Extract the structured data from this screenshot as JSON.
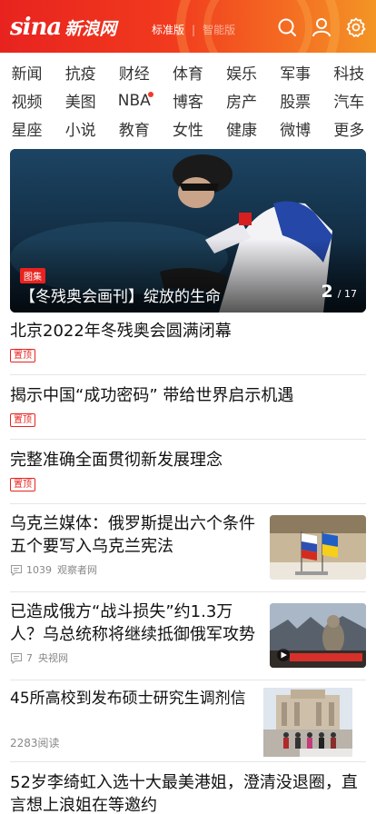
{
  "header": {
    "logo_text": "sina",
    "logo_cn": "新浪网",
    "version_standard": "标准版",
    "version_smart": "智能版",
    "version_sep": "|"
  },
  "nav": {
    "rows": [
      [
        "新闻",
        "抗疫",
        "财经",
        "体育",
        "娱乐",
        "军事",
        "科技"
      ],
      [
        "视频",
        "美图",
        "NBA",
        "博客",
        "房产",
        "股票",
        "汽车"
      ],
      [
        "星座",
        "小说",
        "教育",
        "女性",
        "健康",
        "微博",
        "更多"
      ]
    ]
  },
  "hero": {
    "tag": "图集",
    "title": "【冬残奥会画刊】绽放的生命",
    "page_current": "2",
    "page_total": "/ 17"
  },
  "news": [
    {
      "title": "北京2022年冬残奥会圆满闭幕",
      "badge": "置顶"
    },
    {
      "title": "揭示中国“成功密码” 带给世界启示机遇",
      "badge": "置顶"
    },
    {
      "title": "完整准确全面贯彻新发展理念",
      "badge": "置顶"
    },
    {
      "title": "乌克兰媒体：俄罗斯提出六个条件五个要写入乌克兰宪法",
      "comments": "1039",
      "source": "观察者网"
    },
    {
      "title": "已造成俄方“战斗损失”约1.3万人？乌总统称将继续抵御俄军攻势",
      "comments": "7",
      "source": "央视网"
    },
    {
      "title": "45所高校到发布硕士研究生调剂信",
      "reads": "2283阅读"
    },
    {
      "title": "52岁李绮虹入选十大最美港姐，澄清没退圈，直言想上浪姐在等邀约"
    }
  ],
  "colors": {
    "brand": "#e8231f",
    "accent": "#f39525"
  }
}
